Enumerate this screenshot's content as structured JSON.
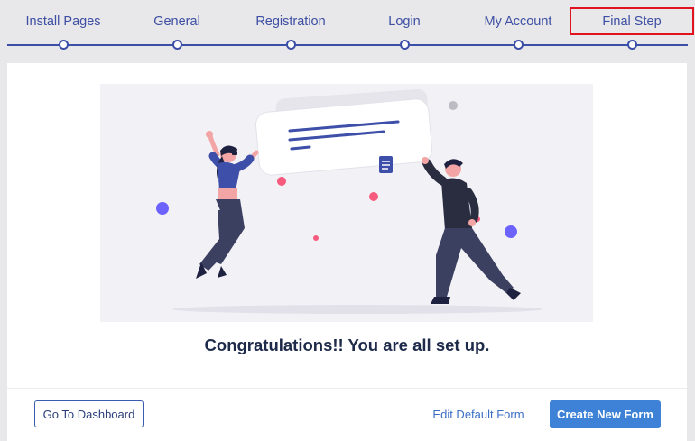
{
  "steps": [
    {
      "label": "Install Pages"
    },
    {
      "label": "General"
    },
    {
      "label": "Registration"
    },
    {
      "label": "Login"
    },
    {
      "label": "My Account"
    },
    {
      "label": "Final Step"
    }
  ],
  "active_step": "Final Step",
  "main": {
    "illustration_icon": "celebration-illustration",
    "message": "Congratulations!! You are all set up."
  },
  "footer": {
    "dashboard_label": "Go To Dashboard",
    "edit_form_label": "Edit Default Form",
    "create_form_label": "Create New Form"
  },
  "colors": {
    "accent": "#3b4fa7",
    "primary_button": "#3d82d6",
    "highlight_box": "#e0141e",
    "background": "#e8e8ea"
  }
}
